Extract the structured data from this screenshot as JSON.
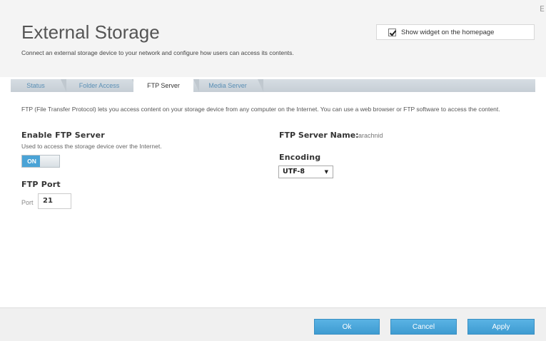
{
  "header": {
    "title": "External Storage",
    "subtitle": "Connect an external storage device to your network and configure how users can access its contents.",
    "close_glyph": "E",
    "widget_label": "Show widget on the homepage",
    "widget_checked": true
  },
  "tabs": [
    {
      "label": "Status",
      "active": false
    },
    {
      "label": "Folder Access",
      "active": false
    },
    {
      "label": "FTP Server",
      "active": true
    },
    {
      "label": "Media Server",
      "active": false
    }
  ],
  "main": {
    "description": "FTP (File Transfer Protocol) lets you access content on your storage device from any computer on the Internet. You can use a web browser or FTP software to access the content.",
    "enable": {
      "title": "Enable FTP Server",
      "subtitle": "Used to access the storage device over the Internet.",
      "toggle_label": "ON",
      "state": true
    },
    "port": {
      "title": "FTP Port",
      "label": "Port",
      "value": "21"
    },
    "server_name": {
      "label": "FTP Server Name:",
      "value": "arachnid"
    },
    "encoding": {
      "title": "Encoding",
      "selected": "UTF-8"
    }
  },
  "footer": {
    "ok": "Ok",
    "cancel": "Cancel",
    "apply": "Apply"
  }
}
